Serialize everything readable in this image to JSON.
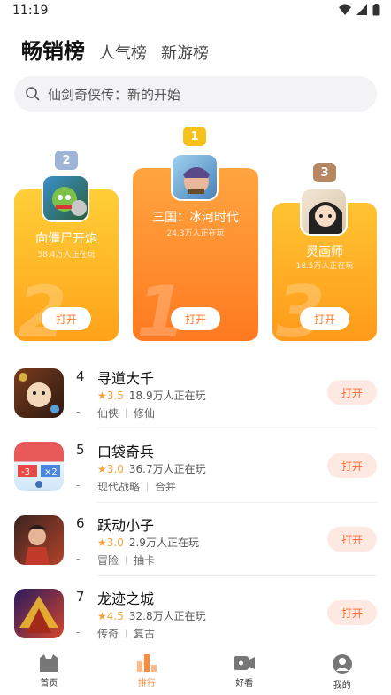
{
  "status": {
    "time": "11:19"
  },
  "tabs": [
    {
      "label": "畅销榜"
    },
    {
      "label": "人气榜"
    },
    {
      "label": "新游榜"
    }
  ],
  "search": {
    "placeholder": "仙剑奇侠传：新的开始"
  },
  "podium": [
    {
      "rank": "2",
      "name": "向僵尸开炮",
      "players": "58.4万人正在玩",
      "open": "打开",
      "big": "2"
    },
    {
      "rank": "1",
      "name": "三国：冰河时代",
      "players": "24.3万人正在玩",
      "open": "打开",
      "big": "1"
    },
    {
      "rank": "3",
      "name": "灵画师",
      "players": "18.5万人正在玩",
      "open": "打开",
      "big": "3"
    }
  ],
  "list": [
    {
      "rank": "4",
      "title": "寻道大千",
      "score": "3.5",
      "players": "18.9万人正在玩",
      "tags": [
        "仙侠",
        "修仙"
      ],
      "dash": "-",
      "open": "打开"
    },
    {
      "rank": "5",
      "title": "口袋奇兵",
      "score": "3.0",
      "players": "36.7万人正在玩",
      "tags": [
        "现代战略",
        "合并"
      ],
      "dash": "-",
      "open": "打开"
    },
    {
      "rank": "6",
      "title": "跃动小子",
      "score": "3.0",
      "players": "2.9万人正在玩",
      "tags": [
        "冒险",
        "抽卡"
      ],
      "dash": "-",
      "open": "打开"
    },
    {
      "rank": "7",
      "title": "龙迹之城",
      "score": "4.5",
      "players": "32.8万人正在玩",
      "tags": [
        "传奇",
        "复古"
      ],
      "dash": "-",
      "open": "打开"
    }
  ],
  "nav": [
    {
      "label": "首页"
    },
    {
      "label": "排行"
    },
    {
      "label": "好看"
    },
    {
      "label": "我的"
    }
  ],
  "colors": {
    "accent": "#ff7a21",
    "star": "#f2a33a",
    "open_bg": "#fde9e1"
  }
}
